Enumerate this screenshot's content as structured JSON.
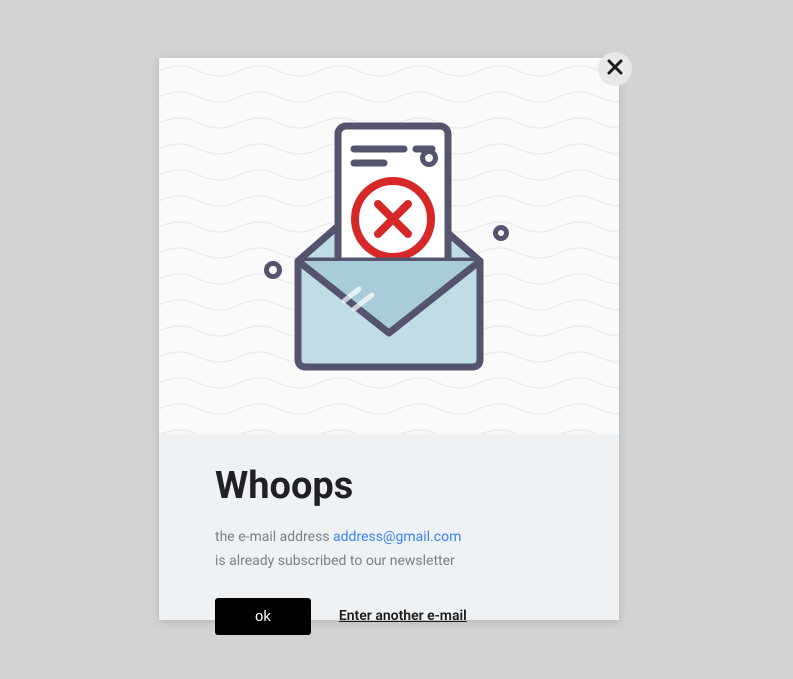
{
  "modal": {
    "title": "Whoops",
    "message_prefix": "the e-mail address ",
    "email": "address@gmail.com",
    "message_suffix": "is already subscribed to our newsletter",
    "ok_label": "ok",
    "enter_another_label": "Enter another e-mail"
  }
}
